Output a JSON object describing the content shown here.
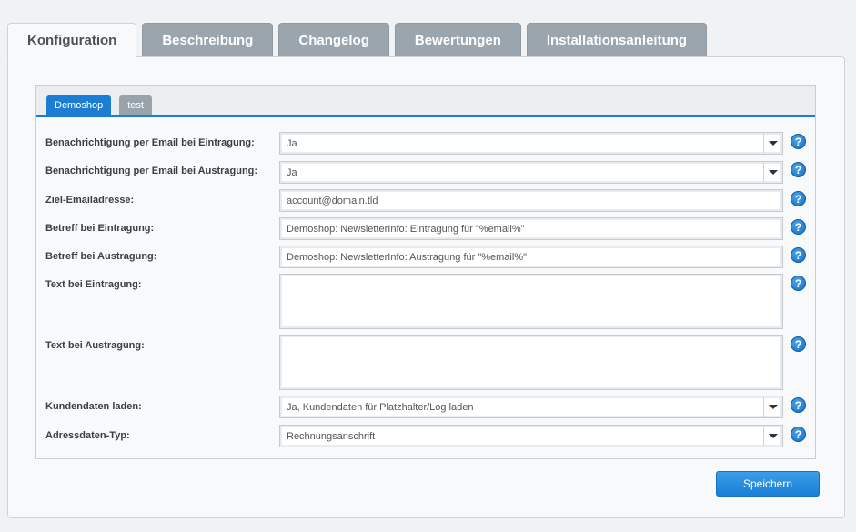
{
  "tabs": [
    "Konfiguration",
    "Beschreibung",
    "Changelog",
    "Bewertungen",
    "Installationsanleitung"
  ],
  "subtabs": [
    "Demoshop",
    "test"
  ],
  "fields": {
    "email_eintragung": {
      "label": "Benachrichtigung per Email bei Eintragung:",
      "value": "Ja"
    },
    "email_austragung": {
      "label": "Benachrichtigung per Email bei Austragung:",
      "value": "Ja"
    },
    "ziel_email": {
      "label": "Ziel-Emailadresse:",
      "value": "account@domain.tld"
    },
    "betreff_eintragung": {
      "label": "Betreff bei Eintragung:",
      "value": "Demoshop: NewsletterInfo: Eintragung für \"%email%\""
    },
    "betreff_austragung": {
      "label": "Betreff bei Austragung:",
      "value": "Demoshop: NewsletterInfo: Austragung für \"%email%\""
    },
    "text_eintragung": {
      "label": "Text bei Eintragung:",
      "value": ""
    },
    "text_austragung": {
      "label": "Text bei Austragung:",
      "value": ""
    },
    "kundendaten": {
      "label": "Kundendaten laden:",
      "value": "Ja, Kundendaten für Platzhalter/Log laden"
    },
    "adressdaten": {
      "label": "Adressdaten-Typ:",
      "value": "Rechnungsanschrift"
    }
  },
  "help_glyph": "?",
  "save_label": "Speichern",
  "colors": {
    "accent": "#1b7ed4",
    "tab_inactive": "#9aa5ae"
  }
}
